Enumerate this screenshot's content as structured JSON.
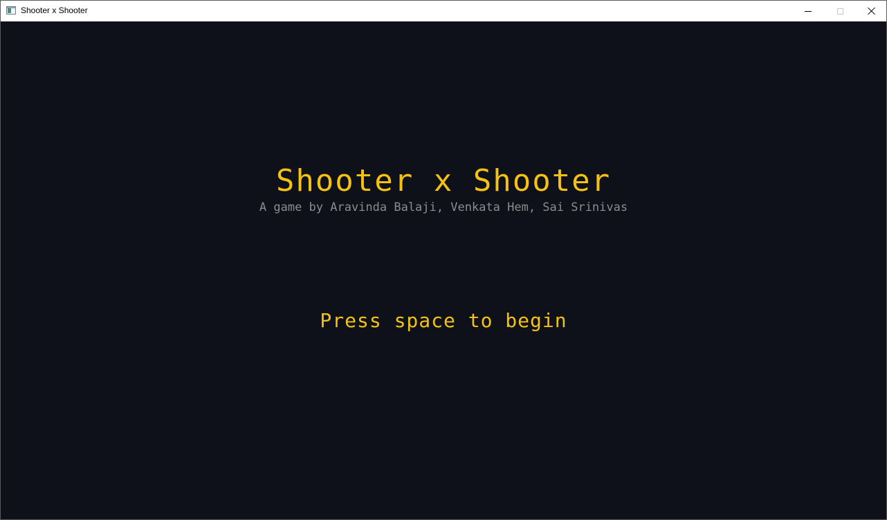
{
  "window": {
    "title": "Shooter x Shooter",
    "icon": "app-window-icon",
    "controls": {
      "minimize_icon": "minimize-icon",
      "maximize_icon": "maximize-icon",
      "close_icon": "close-icon"
    }
  },
  "game": {
    "title": "Shooter x Shooter",
    "subtitle": "A game by Aravinda Balaji, Venkata Hem, Sai Srinivas",
    "prompt": "Press space to begin"
  },
  "colors": {
    "background": "#0e111a",
    "accent": "#f5c211",
    "subtitle": "#8c8c8c"
  }
}
